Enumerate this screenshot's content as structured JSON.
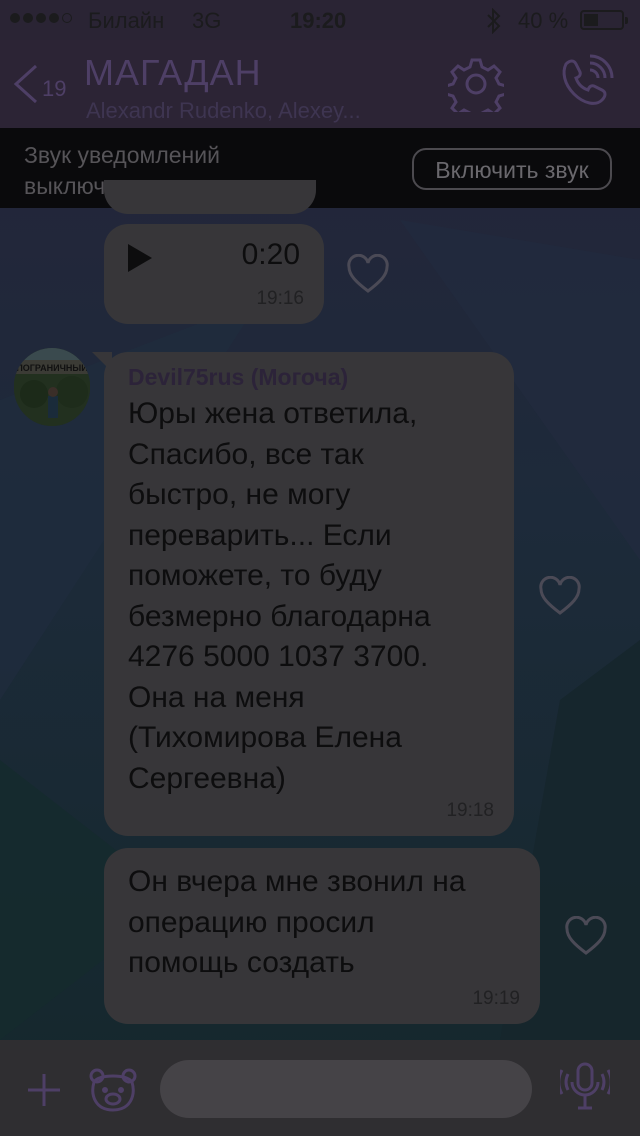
{
  "status": {
    "carrier": "Билайн",
    "network": "3G",
    "time": "19:20",
    "battery": "40 %"
  },
  "header": {
    "back_count": "19",
    "title": "МАГАДАН",
    "subtitle": "Alexandr  Rudenko, Alexey..."
  },
  "notification": {
    "text": "Звук уведомлений выключен",
    "button": "Включить звук"
  },
  "messages": [
    {
      "type": "voice",
      "duration": "0:20",
      "time": "19:16"
    },
    {
      "type": "text",
      "sender": "Devil75rus (Могоча)",
      "lines": [
        "Юры жена ответила,",
        "Спасибо, все так",
        "быстро, не могу",
        "переварить... Если",
        "поможете, то буду",
        "безмерно благодарна",
        "4276 5000 1037 3700.",
        "Она на меня",
        "(Тихомирова Елена",
        "Сергеевна)"
      ],
      "time": "19:18",
      "avatar_text": "ПОГРАНИЧНЫЙ"
    },
    {
      "type": "text",
      "lines": [
        "Он вчера мне звонил на",
        "операцию просил",
        "помощь создать"
      ],
      "time": "19:19"
    }
  ],
  "input": {
    "placeholder": ""
  },
  "icons": {
    "back": "chevron-left-icon",
    "settings": "gear-icon",
    "call": "phone-icon",
    "play": "play-icon",
    "like": "heart-icon",
    "add": "plus-icon",
    "sticker": "bear-sticker-icon",
    "voice": "microphone-icon"
  },
  "colors": {
    "accent": "#4e3f66",
    "header_bg": "#2c2435",
    "bubble_bg": "#373639"
  }
}
